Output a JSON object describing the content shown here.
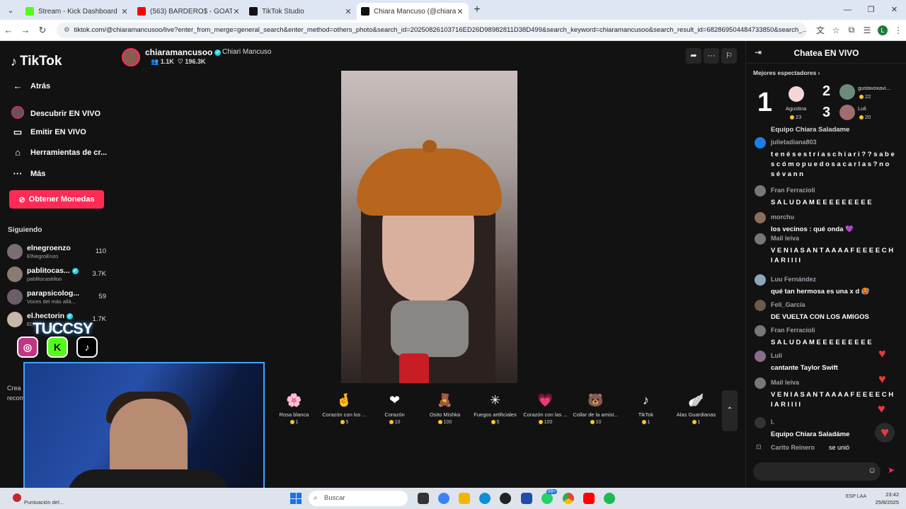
{
  "tabs": [
    {
      "title": "Stream - Kick Dashboard",
      "color": "#53fc18",
      "active": false
    },
    {
      "title": "(563) BARDERO$ - GOAT (Vide",
      "color": "#ff0000",
      "active": false
    },
    {
      "title": "TikTok Studio",
      "color": "#111111",
      "active": false
    },
    {
      "title": "Chiara Mancuso (@chiaram",
      "color": "#111111",
      "active": true
    }
  ],
  "url": "tiktok.com/@chiaramancusoo/live?enter_from_merge=general_search&enter_method=others_photo&search_id=20250826103716ED26D98982811D38D499&search_keyword=chiaramancusoo&search_result_id=682869504484733850&search_...",
  "sidebar": {
    "logo": "TikTok",
    "back": "Atrás",
    "items": [
      {
        "label": "Descubrir EN VIVO",
        "icon": "live-avatar-icon"
      },
      {
        "label": "Emitir EN VIVO",
        "icon": "camera-icon"
      },
      {
        "label": "Herramientas de cr...",
        "icon": "home-icon"
      },
      {
        "label": "Más",
        "icon": "more-dots-icon"
      }
    ],
    "coins_button": "Obtener Monedas",
    "following_heading": "Siguiendo",
    "following": [
      {
        "name": "elnegroenzo",
        "sub": "ElNegroEnzo",
        "count": "110"
      },
      {
        "name": "pablitocas...",
        "sub": "pablitocastiiloo",
        "count": "3.7K",
        "verified": true
      },
      {
        "name": "parapsicolog...",
        "sub": "Voces del más allá...",
        "count": "59"
      },
      {
        "name": "el.hectorin",
        "sub": "El...",
        "count": "1.7K",
        "verified": true
      }
    ],
    "fragments": [
      "Crea",
      "recom"
    ]
  },
  "stream": {
    "username": "chiaramancusoo",
    "nickname": "Chiari Mancuso",
    "viewers": "1.1K",
    "likes": "196.3K"
  },
  "overlay": {
    "brand": "TUCCSY"
  },
  "gifts": [
    {
      "name": "Rosa blanca",
      "price": "1",
      "icon": "🌸"
    },
    {
      "name": "Corazón con los ...",
      "price": "5",
      "icon": "🤞"
    },
    {
      "name": "Corazón",
      "price": "10",
      "icon": "❤"
    },
    {
      "name": "Osito Mishka",
      "price": "100",
      "icon": "🧸"
    },
    {
      "name": "Fuegos artificiales",
      "price": "5",
      "icon": "✳"
    },
    {
      "name": "Corazón con las ...",
      "price": "100",
      "icon": "💗"
    },
    {
      "name": "Collar de la amist...",
      "price": "10",
      "icon": "🐻"
    },
    {
      "name": "TikTok",
      "price": "1",
      "icon": "♪"
    },
    {
      "name": "Alas Guardianas",
      "price": "1",
      "icon": "🪽"
    }
  ],
  "chat": {
    "title": "Chatea EN VIVO",
    "top_heading": "Mejores espectadores",
    "top": [
      {
        "rank": "1",
        "name": "Agustina",
        "points": "23"
      },
      {
        "rank": "2",
        "name": "gustavoxavi...",
        "points": "22"
      },
      {
        "rank": "3",
        "name": "Luli",
        "points": "20"
      }
    ],
    "truncated_top": "Equipo Chiara Saladame",
    "messages": [
      {
        "user": "julietadiana803",
        "text": "t e n é s e s t r í a s c h i a r i ? ? s a b e s c ó m o p u e d o s a c a r l a s ? n o s é v a n n"
      },
      {
        "user": "Fran Ferracioli",
        "text": "S A L U D A M E E E E E E E E E"
      },
      {
        "user": "morchu",
        "text": "los vecinos : qué onda 💜"
      },
      {
        "user": "Mail leiva",
        "text": "V E N I A S A N T A A A A F E E E E C H I A R I I I I"
      },
      {
        "user": "Luu Fernández",
        "text": "qué tan hermosa es una x d 🥵"
      },
      {
        "user": "Feli_García",
        "text": "DE VUELTA CON LOS AMIGOS"
      },
      {
        "user": "Fran Ferracioli",
        "text": "S A L U D A M E E E E E E E E E"
      },
      {
        "user": "Luli",
        "text": "cantante Taylor Swift"
      },
      {
        "user": "Mail leiva",
        "text": "V E N I A S A N T A A A A F E E E E C H I A R I I I I"
      },
      {
        "user": "l.",
        "text": "Equipo Chiara Saladáme"
      }
    ],
    "join_user": "Carito Reinero",
    "join_text": "se unió"
  },
  "taskbar": {
    "info": "Puntuación del...",
    "search": "Buscar",
    "lang": "ESP LAA",
    "time": "23:42",
    "date": "25/8/2025",
    "badge": "99+"
  }
}
